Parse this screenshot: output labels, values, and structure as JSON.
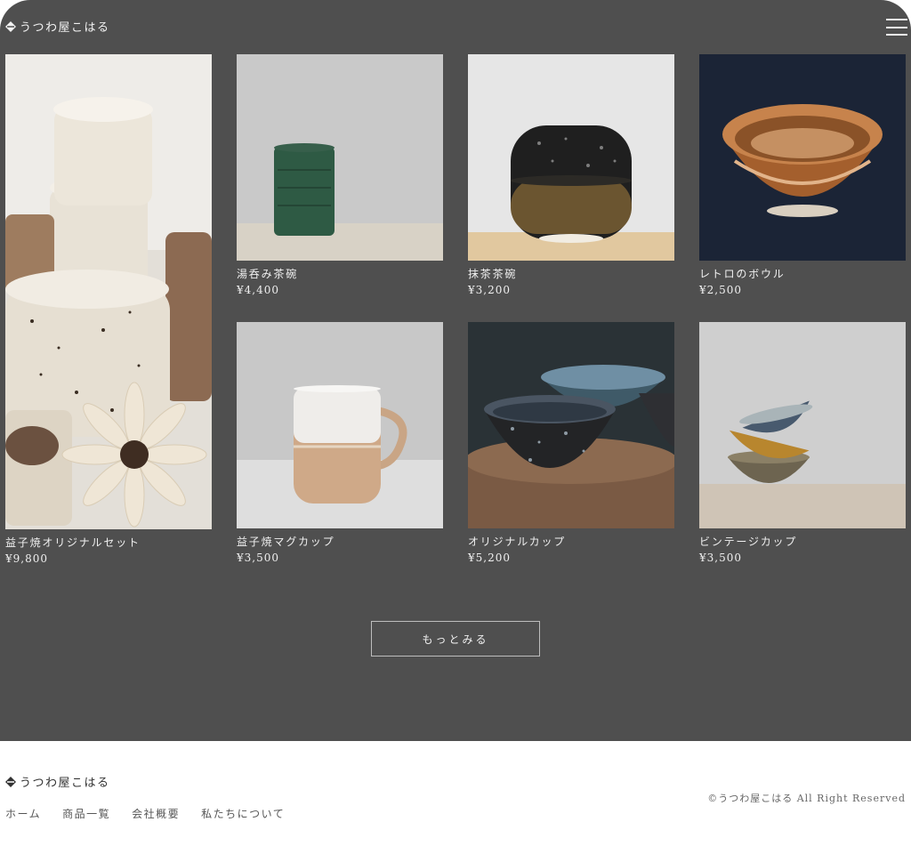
{
  "header": {
    "logo_text": "うつわ屋こはる",
    "logo_icon": "diamond-logo-icon",
    "menu_icon": "hamburger-menu-icon"
  },
  "products": [
    {
      "name": "益子焼オリジナルセット",
      "price": "¥9,800"
    },
    {
      "name": "湯呑み茶碗",
      "price": "¥4,400"
    },
    {
      "name": "抹茶茶碗",
      "price": "¥3,200"
    },
    {
      "name": "レトロのボウル",
      "price": "¥2,500"
    },
    {
      "name": "益子焼マグカップ",
      "price": "¥3,500"
    },
    {
      "name": "オリジナルカップ",
      "price": "¥5,200"
    },
    {
      "name": "ビンテージカップ",
      "price": "¥3,500"
    }
  ],
  "more_button": "もっとみる",
  "footer": {
    "logo_text": "うつわ屋こはる",
    "nav": [
      "ホーム",
      "商品一覧",
      "会社概要",
      "私たちについて"
    ],
    "copyright": "©うつわ屋こはる All Right Reserved"
  },
  "colors": {
    "background": "#4f4f4f",
    "footer_background": "#ffffff",
    "text_light": "#f0f0f0"
  }
}
